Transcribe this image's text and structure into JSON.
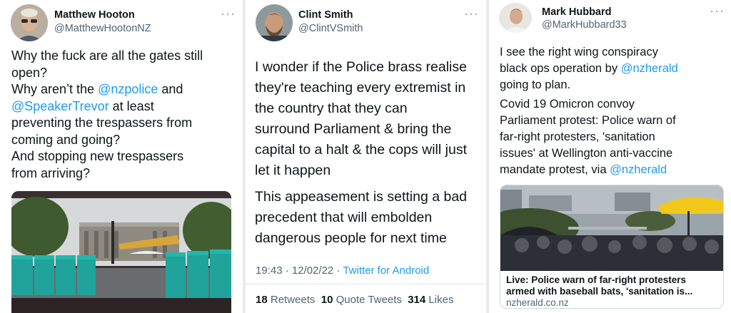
{
  "tweets": [
    {
      "author": "Matthew Hooton",
      "handle": "@MatthewHootonNZ",
      "more_icon": "more-horizontal-icon",
      "text": {
        "l1": "Why the fuck are all the gates still",
        "l2": "open?",
        "l3a": "Why aren’t the ",
        "l3link": "@nzpolice",
        "l3b": " and",
        "l4link": "@SpeakerTrevor",
        "l4b": " at least",
        "l5": "preventing the trespassers from",
        "l6": "coming and going?",
        "l7": "And stopping new trespassers",
        "l8": "from arriving?"
      }
    },
    {
      "author": "Clint Smith",
      "handle": "@ClintVSmith",
      "more_icon": "more-horizontal-icon",
      "text": {
        "l1": "I wonder if the Police brass realise",
        "l2": "they're teaching every extremist in",
        "l3": "the country that they can",
        "l4": "surround Parliament & bring the",
        "l5": "capital to a halt & the cops will just",
        "l6": "let it happen",
        "l7": "This appeasement is setting a bad",
        "l8": "precedent that will embolden",
        "l9": "dangerous people for next time"
      },
      "time": "19:43 · 12/02/22 · ",
      "source": "Twitter for Android",
      "retweets_count": "18",
      "retweets_label": "Retweets",
      "quotes_count": "10",
      "quotes_label": "Quote Tweets",
      "likes_count": "314",
      "likes_label": "Likes"
    },
    {
      "author": "Mark Hubbard",
      "handle": "@MarkHubbard33",
      "more_icon": "more-horizontal-icon",
      "text": {
        "l1": "I see the right wing conspiracy",
        "l2a": "black ops operation by ",
        "l2link": "@nzherald",
        "l3": "going to plan.",
        "l4": "Covid 19 Omicron convoy",
        "l5": "Parliament protest: Police warn of",
        "l6": "far-right protesters, 'sanitation",
        "l7": "issues' at Wellington anti-vaccine",
        "l8a": "mandate protest, via ",
        "l8link": "@nzherald"
      },
      "card": {
        "title1": "Live: Police warn of far-right protesters",
        "title2": "armed with baseball bats, 'sanitation is...",
        "domain": "nzherald.co.nz"
      }
    }
  ]
}
